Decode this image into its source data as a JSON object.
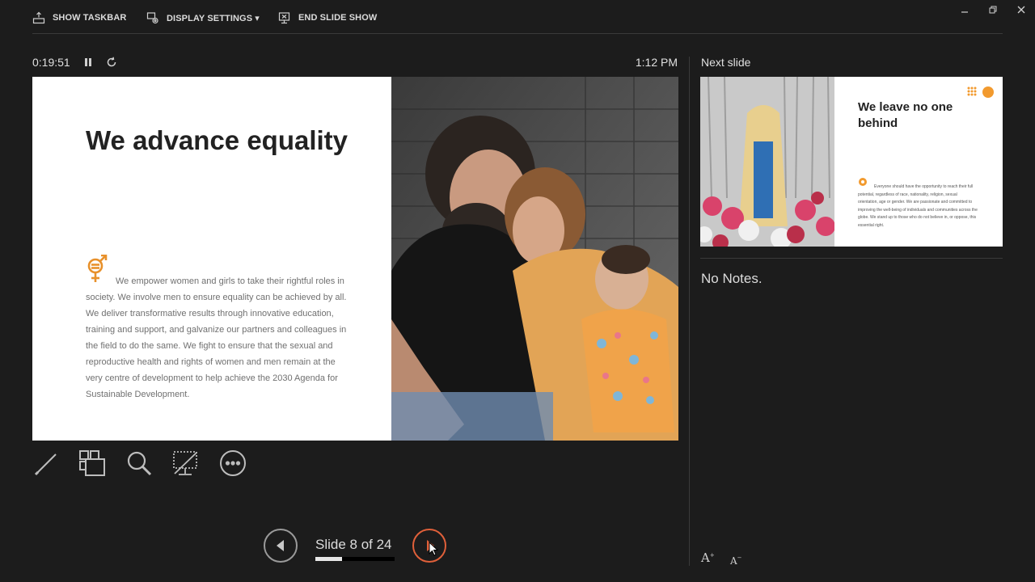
{
  "toolbar": {
    "show_taskbar": "SHOW TASKBAR",
    "display_settings": "DISPLAY SETTINGS ▾",
    "end_slide_show": "END SLIDE SHOW"
  },
  "timer": {
    "elapsed": "0:19:51",
    "clock": "1:12 PM"
  },
  "current_slide": {
    "title": "We advance equality",
    "body": "We empower women and girls to take their rightful roles in society. We involve men to ensure equality can be achieved by all. We deliver transformative results through innovative education, training and support, and galvanize our partners and colleagues in the field to do the same. We fight to ensure that the sexual and reproductive health and rights of women and men remain at the very centre of development to help achieve the 2030 Agenda for Sustainable Development.",
    "accent_color": "#e8912b"
  },
  "tools": [
    "pen-tool",
    "see-all-slides",
    "zoom",
    "black-screen",
    "more-options"
  ],
  "navigation": {
    "slide_counter": "Slide 8 of 24",
    "progress": 0.333,
    "next_accent": "#e0603a"
  },
  "next_slide": {
    "label": "Next slide",
    "title": "We leave no one behind",
    "body": "Everyone should have the opportunity to reach their full potential, regardless of race, nationality, religion, sexual orientation, age or gender. We are passionate and committed to improving the well-being of individuals and communities across the globe. We stand up to those who do not believe in, or oppose, this essential right."
  },
  "notes": {
    "text": "No Notes."
  },
  "font_controls": {
    "increase": "A",
    "decrease": "A"
  }
}
